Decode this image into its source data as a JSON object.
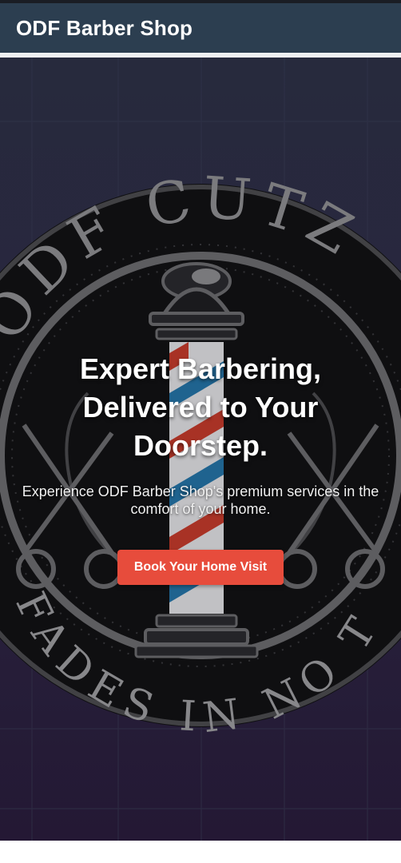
{
  "header": {
    "brand": "ODF Barber Shop"
  },
  "logo": {
    "top_text": "ODF CUTZ",
    "bottom_text": "FADES IN NO TI"
  },
  "hero": {
    "title": "Expert Barbering, Delivered to Your Doorstep.",
    "subtitle": "Experience ODF Barber Shop's premium services in the comfort of your home.",
    "cta_label": "Book Your Home Visit"
  },
  "colors": {
    "navbar": "#2c3e50",
    "cta": "#e74c3c",
    "hero_bg": "#2d3046"
  }
}
